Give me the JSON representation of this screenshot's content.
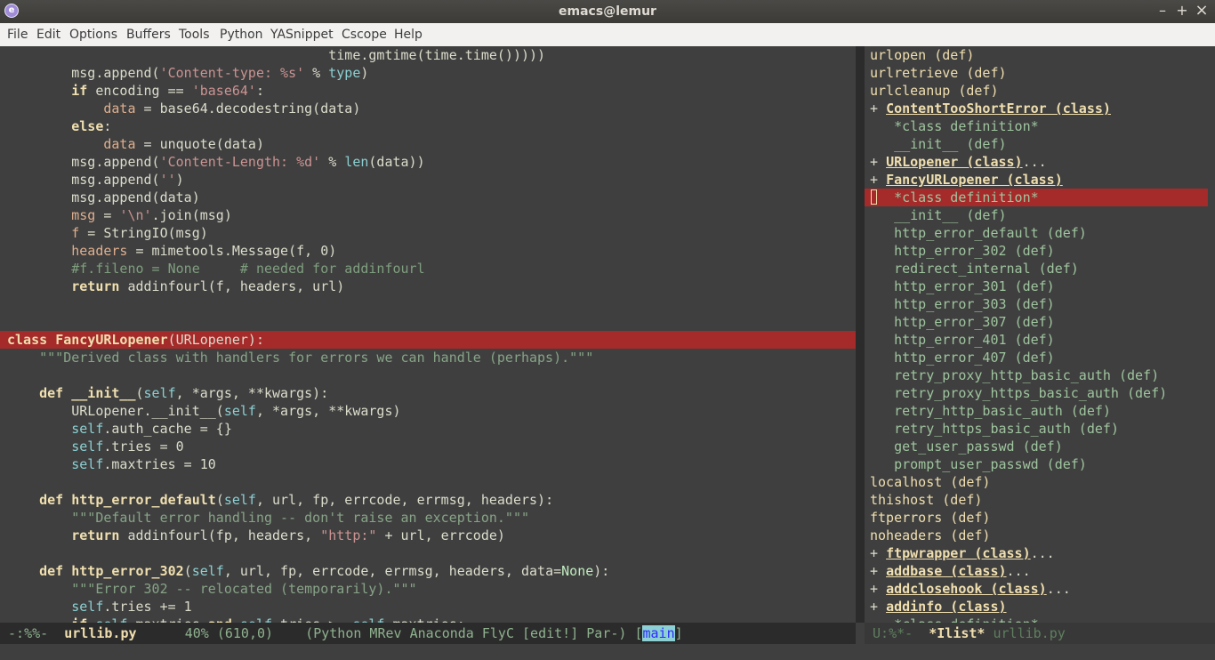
{
  "window": {
    "title": "emacs@lemur",
    "minimize": "–",
    "maximize": "+",
    "close": "×",
    "icon_glyph": "e"
  },
  "menubar": [
    "File",
    "Edit",
    "Options",
    "Buffers",
    "Tools",
    "Python",
    "YASnippet",
    "Cscope",
    "Help"
  ],
  "editor": {
    "lines": [
      [
        {
          "t": "                                        time.gmtime(time.time()))))",
          "c": ""
        }
      ],
      [
        {
          "t": "        msg.append(",
          "c": ""
        },
        {
          "t": "'Content-type: %s'",
          "c": "str"
        },
        {
          "t": " % ",
          "c": ""
        },
        {
          "t": "type",
          "c": "kw"
        },
        {
          "t": ")",
          "c": ""
        }
      ],
      [
        {
          "t": "        ",
          "c": ""
        },
        {
          "t": "if",
          "c": "kwb"
        },
        {
          "t": " encoding == ",
          "c": ""
        },
        {
          "t": "'base64'",
          "c": "str"
        },
        {
          "t": ":",
          "c": ""
        }
      ],
      [
        {
          "t": "            ",
          "c": ""
        },
        {
          "t": "data",
          "c": "var"
        },
        {
          "t": " = base64.decodestring(data)",
          "c": ""
        }
      ],
      [
        {
          "t": "        ",
          "c": ""
        },
        {
          "t": "else",
          "c": "kwb"
        },
        {
          "t": ":",
          "c": ""
        }
      ],
      [
        {
          "t": "            ",
          "c": ""
        },
        {
          "t": "data",
          "c": "var"
        },
        {
          "t": " = unquote(data)",
          "c": ""
        }
      ],
      [
        {
          "t": "        msg.append(",
          "c": ""
        },
        {
          "t": "'Content-Length: %d'",
          "c": "str"
        },
        {
          "t": " % ",
          "c": ""
        },
        {
          "t": "len",
          "c": "kw"
        },
        {
          "t": "(data))",
          "c": ""
        }
      ],
      [
        {
          "t": "        msg.append(",
          "c": ""
        },
        {
          "t": "''",
          "c": "str"
        },
        {
          "t": ")",
          "c": ""
        }
      ],
      [
        {
          "t": "        msg.append(data)",
          "c": ""
        }
      ],
      [
        {
          "t": "        ",
          "c": ""
        },
        {
          "t": "msg",
          "c": "var"
        },
        {
          "t": " = ",
          "c": ""
        },
        {
          "t": "'\\n'",
          "c": "str"
        },
        {
          "t": ".join(msg)",
          "c": ""
        }
      ],
      [
        {
          "t": "        ",
          "c": ""
        },
        {
          "t": "f",
          "c": "var"
        },
        {
          "t": " = StringIO(msg)",
          "c": ""
        }
      ],
      [
        {
          "t": "        ",
          "c": ""
        },
        {
          "t": "headers",
          "c": "var"
        },
        {
          "t": " = mimetools.Message(f, 0)",
          "c": ""
        }
      ],
      [
        {
          "t": "        #f.fileno = None     # needed for addinfourl",
          "c": "cmt"
        }
      ],
      [
        {
          "t": "        ",
          "c": ""
        },
        {
          "t": "return",
          "c": "kwb"
        },
        {
          "t": " addinfourl(f, headers, url)",
          "c": ""
        }
      ],
      [],
      [],
      [
        {
          "t": "class",
          "c": "kwb"
        },
        {
          "t": " ",
          "c": ""
        },
        {
          "t": "FancyURLopener",
          "c": "fn"
        },
        {
          "t": "(URLopener):",
          "c": ""
        }
      ],
      [
        {
          "t": "    \"\"\"Derived class with handlers for errors we can handle (perhaps).\"\"\"",
          "c": "doc"
        }
      ],
      [],
      [
        {
          "t": "    ",
          "c": ""
        },
        {
          "t": "def",
          "c": "kwb"
        },
        {
          "t": " ",
          "c": ""
        },
        {
          "t": "__init__",
          "c": "fn"
        },
        {
          "t": "(",
          "c": ""
        },
        {
          "t": "self",
          "c": "self"
        },
        {
          "t": ", *args, **kwargs):",
          "c": ""
        }
      ],
      [
        {
          "t": "        URLopener.__init__(",
          "c": ""
        },
        {
          "t": "self",
          "c": "self"
        },
        {
          "t": ", *args, **kwargs)",
          "c": ""
        }
      ],
      [
        {
          "t": "        ",
          "c": ""
        },
        {
          "t": "self",
          "c": "self"
        },
        {
          "t": ".auth_cache = {}",
          "c": ""
        }
      ],
      [
        {
          "t": "        ",
          "c": ""
        },
        {
          "t": "self",
          "c": "self"
        },
        {
          "t": ".tries = 0",
          "c": ""
        }
      ],
      [
        {
          "t": "        ",
          "c": ""
        },
        {
          "t": "self",
          "c": "self"
        },
        {
          "t": ".maxtries = 10",
          "c": ""
        }
      ],
      [],
      [
        {
          "t": "    ",
          "c": ""
        },
        {
          "t": "def",
          "c": "kwb"
        },
        {
          "t": " ",
          "c": ""
        },
        {
          "t": "http_error_default",
          "c": "fn"
        },
        {
          "t": "(",
          "c": ""
        },
        {
          "t": "self",
          "c": "self"
        },
        {
          "t": ", url, fp, errcode, errmsg, headers):",
          "c": ""
        }
      ],
      [
        {
          "t": "        \"\"\"Default error handling -- don't raise an exception.\"\"\"",
          "c": "doc"
        }
      ],
      [
        {
          "t": "        ",
          "c": ""
        },
        {
          "t": "return",
          "c": "kwb"
        },
        {
          "t": " addinfourl(fp, headers, ",
          "c": ""
        },
        {
          "t": "\"http:\"",
          "c": "str"
        },
        {
          "t": " + url, errcode)",
          "c": ""
        }
      ],
      [],
      [
        {
          "t": "    ",
          "c": ""
        },
        {
          "t": "def",
          "c": "kwb"
        },
        {
          "t": " ",
          "c": ""
        },
        {
          "t": "http_error_302",
          "c": "fn"
        },
        {
          "t": "(",
          "c": ""
        },
        {
          "t": "self",
          "c": "self"
        },
        {
          "t": ", url, fp, errcode, errmsg, headers, data=",
          "c": ""
        },
        {
          "t": "None",
          "c": "none"
        },
        {
          "t": "):",
          "c": ""
        }
      ],
      [
        {
          "t": "        \"\"\"Error 302 -- relocated (temporarily).\"\"\"",
          "c": "doc"
        }
      ],
      [
        {
          "t": "        ",
          "c": ""
        },
        {
          "t": "self",
          "c": "self"
        },
        {
          "t": ".tries += 1",
          "c": ""
        }
      ],
      [
        {
          "t": "        ",
          "c": ""
        },
        {
          "t": "if",
          "c": "kwb"
        },
        {
          "t": " ",
          "c": ""
        },
        {
          "t": "self",
          "c": "self"
        },
        {
          "t": ".maxtries ",
          "c": ""
        },
        {
          "t": "and",
          "c": "kwb"
        },
        {
          "t": " ",
          "c": ""
        },
        {
          "t": "self",
          "c": "self"
        },
        {
          "t": ".tries >= ",
          "c": ""
        },
        {
          "t": "self",
          "c": "self"
        },
        {
          "t": ".maxtries:",
          "c": ""
        }
      ]
    ],
    "highlight_line": 16
  },
  "ilist": {
    "items": [
      {
        "plus": "",
        "name": "urlopen (def)",
        "kind": "def"
      },
      {
        "plus": "",
        "name": "urlretrieve (def)",
        "kind": "def"
      },
      {
        "plus": "",
        "name": "urlcleanup (def)",
        "kind": "def"
      },
      {
        "plus": "+ ",
        "name": "ContentTooShortError (class)",
        "kind": "class",
        "dots": ""
      },
      {
        "plus": "   ",
        "name": "*class definition*",
        "kind": "sub"
      },
      {
        "plus": "   ",
        "name": "__init__ (def)",
        "kind": "sub"
      },
      {
        "plus": "+ ",
        "name": "URLopener (class)",
        "kind": "class",
        "dots": "..."
      },
      {
        "plus": "+ ",
        "name": "FancyURLopener (class)",
        "kind": "class",
        "dots": ""
      },
      {
        "plus": "   ",
        "name": "*class definition*",
        "kind": "sub",
        "hl": true
      },
      {
        "plus": "   ",
        "name": "__init__ (def)",
        "kind": "sub"
      },
      {
        "plus": "   ",
        "name": "http_error_default (def)",
        "kind": "sub"
      },
      {
        "plus": "   ",
        "name": "http_error_302 (def)",
        "kind": "sub"
      },
      {
        "plus": "   ",
        "name": "redirect_internal (def)",
        "kind": "sub"
      },
      {
        "plus": "   ",
        "name": "http_error_301 (def)",
        "kind": "sub"
      },
      {
        "plus": "   ",
        "name": "http_error_303 (def)",
        "kind": "sub"
      },
      {
        "plus": "   ",
        "name": "http_error_307 (def)",
        "kind": "sub"
      },
      {
        "plus": "   ",
        "name": "http_error_401 (def)",
        "kind": "sub"
      },
      {
        "plus": "   ",
        "name": "http_error_407 (def)",
        "kind": "sub"
      },
      {
        "plus": "   ",
        "name": "retry_proxy_http_basic_auth (def)",
        "kind": "sub"
      },
      {
        "plus": "   ",
        "name": "retry_proxy_https_basic_auth (def)",
        "kind": "sub"
      },
      {
        "plus": "   ",
        "name": "retry_http_basic_auth (def)",
        "kind": "sub"
      },
      {
        "plus": "   ",
        "name": "retry_https_basic_auth (def)",
        "kind": "sub"
      },
      {
        "plus": "   ",
        "name": "get_user_passwd (def)",
        "kind": "sub"
      },
      {
        "plus": "   ",
        "name": "prompt_user_passwd (def)",
        "kind": "sub"
      },
      {
        "plus": "",
        "name": "localhost (def)",
        "kind": "def"
      },
      {
        "plus": "",
        "name": "thishost (def)",
        "kind": "def"
      },
      {
        "plus": "",
        "name": "ftperrors (def)",
        "kind": "def"
      },
      {
        "plus": "",
        "name": "noheaders (def)",
        "kind": "def"
      },
      {
        "plus": "+ ",
        "name": "ftpwrapper (class)",
        "kind": "class",
        "dots": "..."
      },
      {
        "plus": "+ ",
        "name": "addbase (class)",
        "kind": "class",
        "dots": "..."
      },
      {
        "plus": "+ ",
        "name": "addclosehook (class)",
        "kind": "class",
        "dots": "..."
      },
      {
        "plus": "+ ",
        "name": "addinfo (class)",
        "kind": "class",
        "dots": ""
      },
      {
        "plus": "   ",
        "name": "*class definition*",
        "kind": "sub"
      }
    ]
  },
  "modeline_left": {
    "status": " -:%%-  ",
    "buffer": "urllib.py",
    "position": "      40% (610,0)    ",
    "modes": "(Python MRev Anaconda FlyC [edit!] Par-) ",
    "bracket_open": "[",
    "main": "main",
    "bracket_close": "]"
  },
  "modeline_right": {
    "status": " U:%*-  ",
    "buffer": "*Ilist*",
    "file": " urllib.py"
  },
  "colors": {
    "background": "#3f3f3f",
    "highlight": "#a52a2a",
    "keyword": "#f0dfaf",
    "string": "#cc9393",
    "builtin": "#8cd0d3"
  }
}
